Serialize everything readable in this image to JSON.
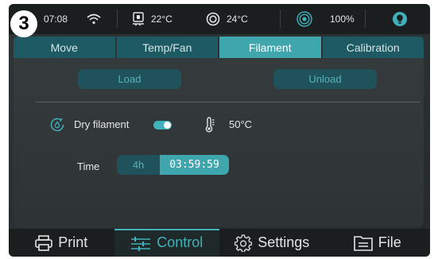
{
  "step_marker": "3",
  "status_bar": {
    "time": "07:08",
    "icons": [
      "wifi-icon",
      "bed-temp-icon",
      "nozzle-temp-icon",
      "light-icon",
      "bulb-icon"
    ],
    "bed_temp": "22°C",
    "nozzle_temp": "24°C",
    "light_level": "100%"
  },
  "tabs": [
    {
      "label": "Move",
      "active": false
    },
    {
      "label": "Temp/Fan",
      "active": false
    },
    {
      "label": "Filament",
      "active": true
    },
    {
      "label": "Calibration",
      "active": false
    }
  ],
  "filament": {
    "load_label": "Load",
    "unload_label": "Unload",
    "dry_label": "Dry filament",
    "dry_enabled": true,
    "dry_temp": "50°C",
    "time_label": "Time",
    "time_hours": "4h",
    "time_remaining": "03:59:59"
  },
  "bottom_nav": [
    {
      "label": "Print",
      "icon": "printer-icon",
      "active": false
    },
    {
      "label": "Control",
      "icon": "sliders-icon",
      "active": true
    },
    {
      "label": "Settings",
      "icon": "gear-icon",
      "active": false
    },
    {
      "label": "File",
      "icon": "file-icon",
      "active": false
    }
  ],
  "colors": {
    "accent": "#3fa6ae",
    "tab_inactive": "#1d5a63",
    "button_bg": "#1f525a",
    "button_text": "#55b3bb",
    "background": "#2f3537",
    "bar_bg": "#1b1e1f"
  }
}
